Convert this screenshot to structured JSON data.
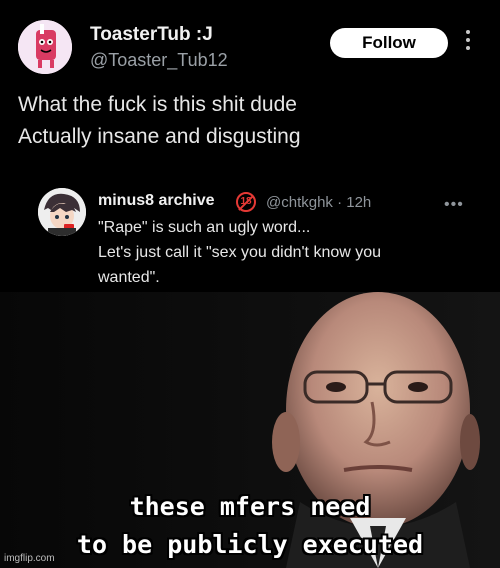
{
  "post": {
    "display_name": "ToasterTub :J",
    "handle": "@Toaster_Tub12",
    "follow_label": "Follow",
    "text_lines": [
      "What the fuck is this shit dude",
      "Actually insane and disgusting"
    ]
  },
  "quoted": {
    "display_name": "minus8 archive",
    "badge_text": "18",
    "meta": "@chtkghk · 12h",
    "more_label": "•••",
    "text_lines": [
      "\"Rape\" is such an ugly word...",
      "Let's just call it \"sex you didn't know you",
      "wanted\"."
    ]
  },
  "meme": {
    "caption_lines": [
      "these mfers need",
      "to be publicly executed"
    ],
    "watermark": "imgflip.com"
  },
  "colors": {
    "background": "#000000",
    "follow_bg": "#ffffff",
    "badge_red": "#e53935"
  },
  "icons": {
    "more": "vertical-ellipsis-icon",
    "badge": "no-under-18-icon"
  }
}
